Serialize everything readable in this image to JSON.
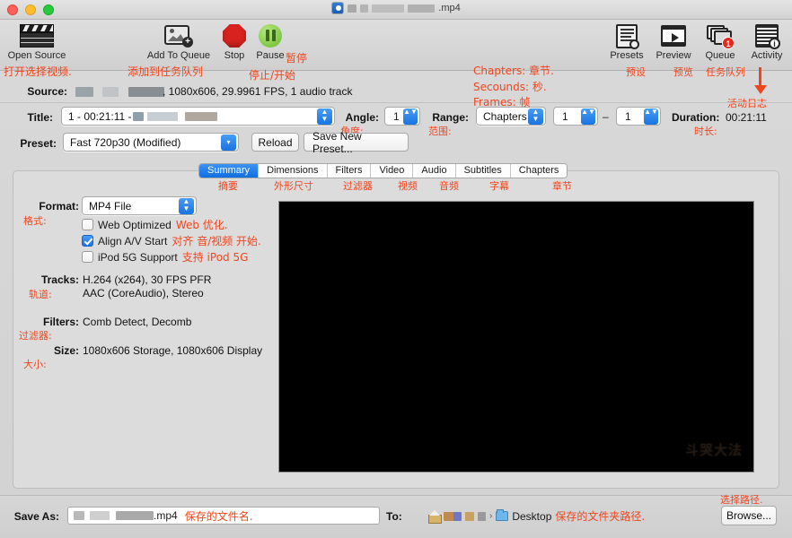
{
  "window": {
    "title_suffix": ".mp4",
    "traffic_lights": [
      "close",
      "minimize",
      "maximize"
    ]
  },
  "toolbar": {
    "items": [
      {
        "label": "Open Source",
        "icon": "clapper-icon",
        "anno": "打开选择视频."
      },
      {
        "label": "Add To Queue",
        "icon": "add-to-queue-icon",
        "anno": "添加到任务队列"
      },
      {
        "label": "Stop",
        "icon": "stop-icon",
        "anno": "停止/开始"
      },
      {
        "label": "Pause",
        "icon": "pause-icon",
        "anno": "暂停"
      },
      {
        "label": "Presets",
        "icon": "presets-icon",
        "anno": "预设"
      },
      {
        "label": "Preview",
        "icon": "preview-icon",
        "anno": "预览"
      },
      {
        "label": "Queue",
        "icon": "queue-icon",
        "anno": "任务队列",
        "badge": "1"
      },
      {
        "label": "Activity",
        "icon": "activity-icon",
        "anno": "活动日志"
      }
    ]
  },
  "source": {
    "label": "Source:",
    "value": ", 1080x606, 29.9961 FPS, 1 audio track"
  },
  "title_row": {
    "label": "Title:",
    "value": "1 - 00:21:11 - ",
    "angle_label": "Angle:",
    "angle_anno": "角度:",
    "angle_value": "1",
    "range_label": "Range:",
    "range_anno": "范围:",
    "range_value": "Chapters",
    "range_start": "1",
    "range_dash": "–",
    "range_end": "1",
    "duration_label": "Duration:",
    "duration_value": "00:21:11",
    "duration_anno": "时长:",
    "range_help": [
      "Chapters: 章节.",
      "Secounds: 秒.",
      "Frames: 帧"
    ]
  },
  "preset_row": {
    "label": "Preset:",
    "value": "Fast 720p30 (Modified)",
    "reload_label": "Reload",
    "save_new_label": "Save New Preset..."
  },
  "tabs": [
    {
      "label": "Summary",
      "anno": "摘要",
      "active": true
    },
    {
      "label": "Dimensions",
      "anno": "外形尺寸",
      "active": false
    },
    {
      "label": "Filters",
      "anno": "过滤器",
      "active": false
    },
    {
      "label": "Video",
      "anno": "视频",
      "active": false
    },
    {
      "label": "Audio",
      "anno": "音频",
      "active": false
    },
    {
      "label": "Subtitles",
      "anno": "字幕",
      "active": false
    },
    {
      "label": "Chapters",
      "anno": "章节",
      "active": false
    }
  ],
  "summary": {
    "format_label": "Format:",
    "format_anno": "格式:",
    "format_value": "MP4 File",
    "checkboxes": [
      {
        "label": "Web Optimized",
        "anno": "Web 优化.",
        "checked": false
      },
      {
        "label": "Align A/V Start",
        "anno": "对齐 音/视频 开始.",
        "checked": true
      },
      {
        "label": "iPod 5G Support",
        "anno": "支持 iPod 5G",
        "checked": false
      }
    ],
    "tracks_label": "Tracks:",
    "tracks_anno": "轨道:",
    "tracks_line1": "H.264 (x264), 30 FPS PFR",
    "tracks_line2": "AAC (CoreAudio), Stereo",
    "filters_label": "Filters:",
    "filters_anno": "过滤器:",
    "filters_value": "Comb Detect, Decomb",
    "size_label": "Size:",
    "size_anno": "大小:",
    "size_value": "1080x606 Storage, 1080x606 Display"
  },
  "preview": {
    "watermark": "斗哭大法"
  },
  "bottom": {
    "save_as_label": "Save As:",
    "save_as_value": ".mp4",
    "save_as_anno": "保存的文件名.",
    "to_label": "To:",
    "destination": "Desktop",
    "to_anno": "保存的文件夹路径.",
    "browse_label": "Browse...",
    "browse_anno": "选择路径."
  },
  "colors": {
    "accent": "#1874e0",
    "annotation": "#f0461e",
    "stop": "#d8221f",
    "pause": "#6aba2e",
    "badge": "#e02b20"
  }
}
